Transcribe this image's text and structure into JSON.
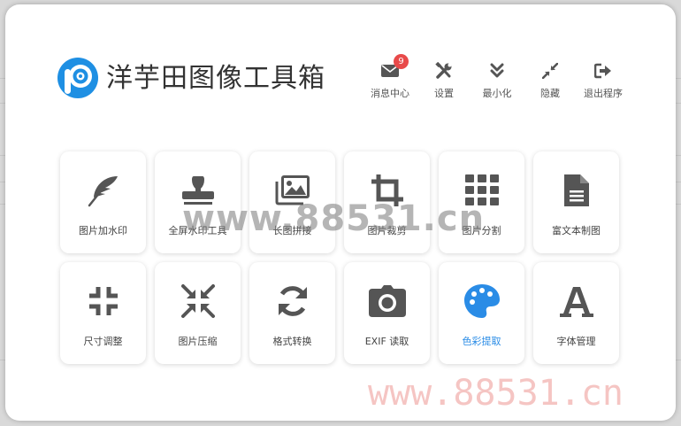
{
  "app": {
    "title": "洋芋田图像工具箱",
    "logo_icon": "app-logo-icon"
  },
  "topbar": [
    {
      "label": "消息中心",
      "icon": "envelope-icon",
      "badge": "9"
    },
    {
      "label": "设置",
      "icon": "tools-icon"
    },
    {
      "label": "最小化",
      "icon": "chevrons-down-icon"
    },
    {
      "label": "隐藏",
      "icon": "compress-arrows-icon"
    },
    {
      "label": "退出程序",
      "icon": "sign-out-icon"
    }
  ],
  "tools": [
    {
      "label": "图片加水印",
      "icon": "feather-icon"
    },
    {
      "label": "全屏水印工具",
      "icon": "stamp-icon"
    },
    {
      "label": "长图拼接",
      "icon": "images-icon"
    },
    {
      "label": "图片裁剪",
      "icon": "crop-icon"
    },
    {
      "label": "图片分割",
      "icon": "grid-icon"
    },
    {
      "label": "富文本制图",
      "icon": "file-text-icon"
    },
    {
      "label": "尺寸调整",
      "icon": "compress-icon"
    },
    {
      "label": "图片压缩",
      "icon": "compress-arrows-icon"
    },
    {
      "label": "格式转换",
      "icon": "sync-icon"
    },
    {
      "label": "EXIF 读取",
      "icon": "camera-icon"
    },
    {
      "label": "色彩提取",
      "icon": "palette-icon",
      "active": true
    },
    {
      "label": "字体管理",
      "icon": "font-icon"
    }
  ],
  "watermarks": {
    "center": "www.88531.cn",
    "corner": "www.88531.cn"
  },
  "colors": {
    "icon": "#555555",
    "accent": "#2a8ce6",
    "badge": "#e84a4a",
    "watermark_corner": "#eb8c87"
  }
}
